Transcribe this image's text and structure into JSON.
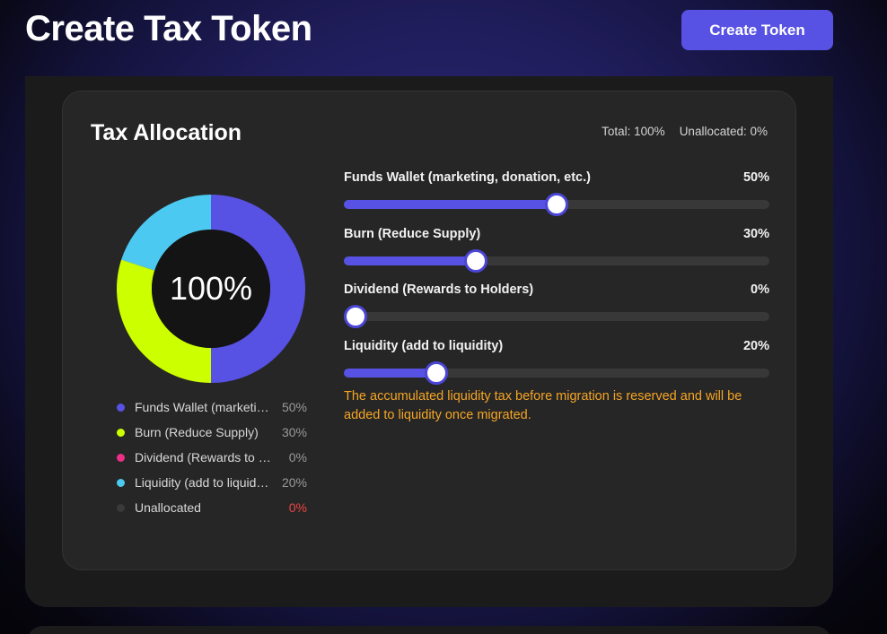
{
  "header": {
    "title": "Create Tax Token",
    "create_button": "Create Token"
  },
  "card": {
    "title": "Tax Allocation",
    "total": "Total: 100%",
    "unallocated": "Unallocated: 0%",
    "donut_center": "100%"
  },
  "colors": {
    "accent": "#5752e3",
    "funds": "#5752e3",
    "burn": "#ccff00",
    "dividend": "#ec2f87",
    "liquidity": "#4cc9f0",
    "unallocated": "#3a3a3a",
    "warning": "#f5a524",
    "error": "#ef4444"
  },
  "allocations": [
    {
      "label": "Funds Wallet (marketing, donation, etc.)",
      "short": "Funds Wallet (marketing, donation, etc.)",
      "value": "50%",
      "percent": 50,
      "color": "#5752e3"
    },
    {
      "label": "Burn (Reduce Supply)",
      "short": "Burn (Reduce Supply)",
      "value": "30%",
      "percent": 30,
      "color": "#ccff00"
    },
    {
      "label": "Dividend (Rewards to Holders)",
      "short": "Dividend (Rewards to Holders)",
      "value": "0%",
      "percent": 0,
      "color": "#ec2f87"
    },
    {
      "label": "Liquidity (add to liquidity)",
      "short": "Liquidity (add to liquidity)",
      "value": "20%",
      "percent": 20,
      "color": "#4cc9f0"
    }
  ],
  "unallocated_legend": {
    "label": "Unallocated",
    "value": "0%"
  },
  "liquidity_note": "The accumulated liquidity tax before migration is reserved and will be added to liquidity once migrated."
}
